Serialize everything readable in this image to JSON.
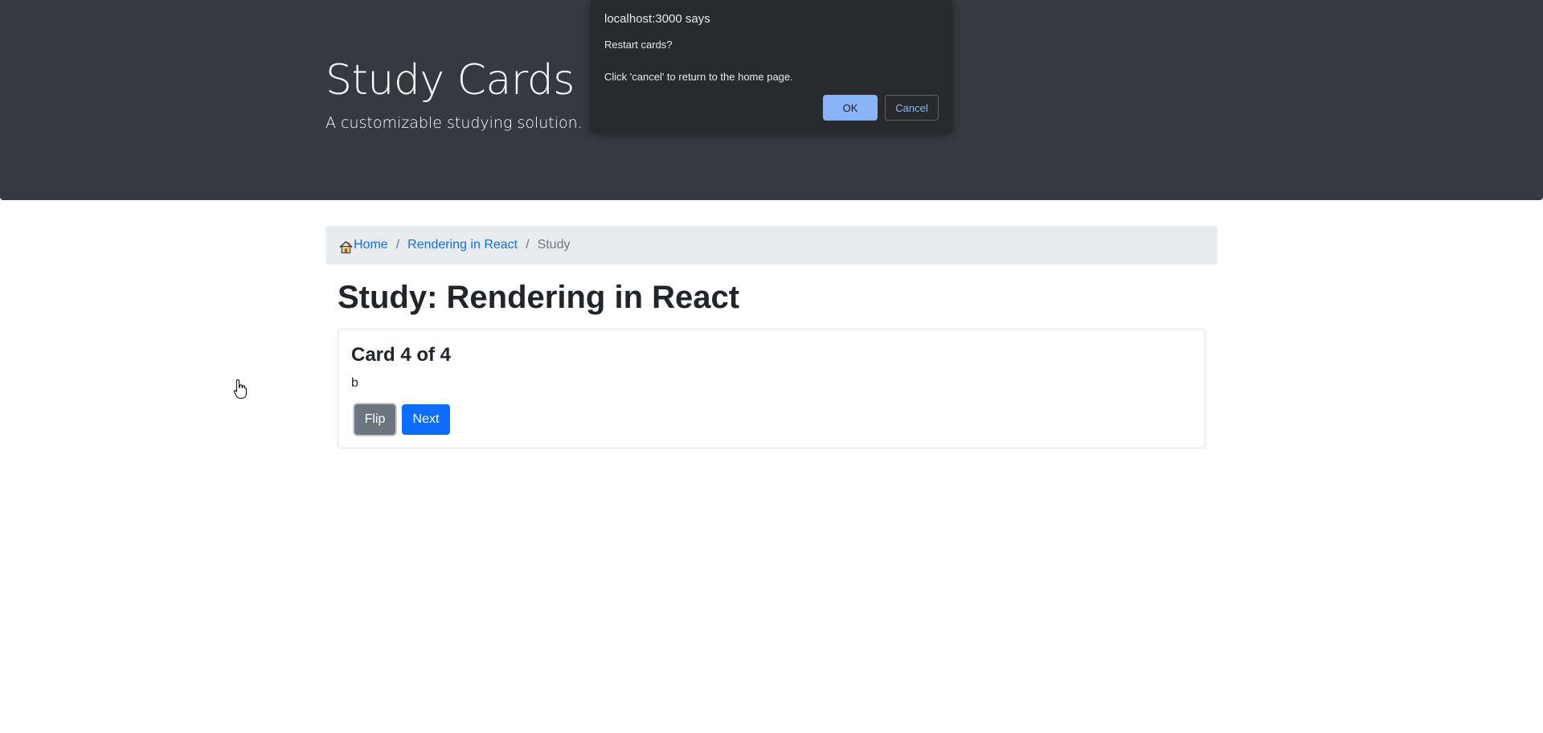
{
  "header": {
    "title": "Study Cards",
    "subtitle": "A customizable studying solution."
  },
  "breadcrumb": {
    "home_label": "Home",
    "deck_label": "Rendering in React",
    "current_label": "Study",
    "separator": "/"
  },
  "main": {
    "heading": "Study: Rendering in React"
  },
  "card": {
    "title": "Card 4 of 4",
    "text": "b",
    "flip_label": "Flip",
    "next_label": "Next"
  },
  "dialog": {
    "title": "localhost:3000 says",
    "message": "Restart cards?\n\nClick 'cancel' to return to the home page.",
    "ok_label": "OK",
    "cancel_label": "Cancel"
  },
  "colors": {
    "header_bg": "#343a40",
    "link": "#0d6efd",
    "flip_button": "#6c757d",
    "next_button": "#0d6efd",
    "dialog_bg": "#292a2d",
    "dialog_ok": "#8ab4f8"
  },
  "icons": {
    "home": "house-icon",
    "cursor": "hand-pointer-icon"
  }
}
